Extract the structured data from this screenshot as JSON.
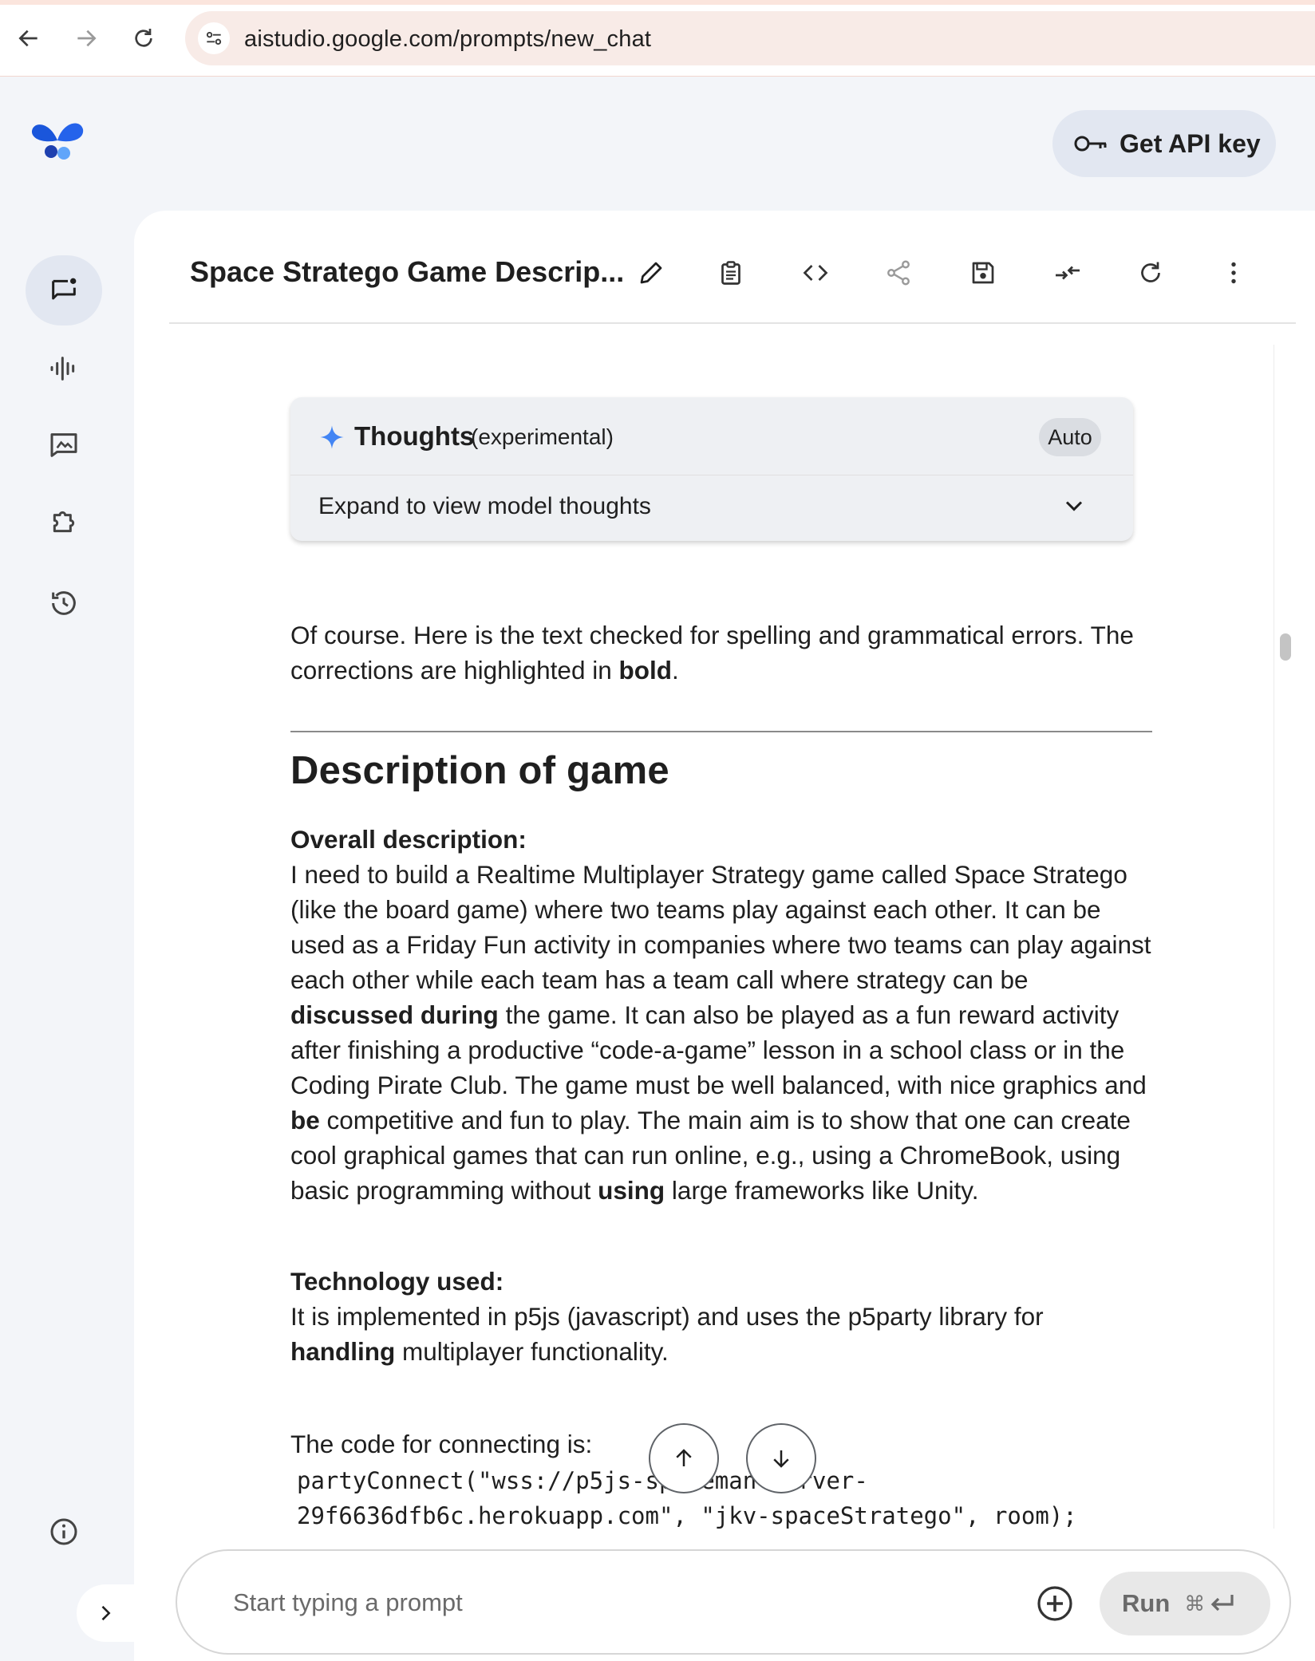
{
  "browser": {
    "url": "aistudio.google.com/prompts/new_chat"
  },
  "header": {
    "api_button_label": "Get API key"
  },
  "toolbar": {
    "title": "Space Stratego Game Descrip..."
  },
  "thoughts": {
    "title": "Thoughts",
    "subtitle": "(experimental)",
    "badge": "Auto",
    "expand_label": "Expand to view model thoughts"
  },
  "response": {
    "intro_1": "Of course. Here is the text checked for spelling and grammatical errors. The corrections are highlighted in ",
    "intro_bold": "bold",
    "intro_2": ".",
    "heading": "Description of game",
    "overall": {
      "label": "Overall description:",
      "t1": "I need to build a Realtime Multiplayer Strategy game called Space Stratego (like the board game) where two teams play against each other. It can be used as a Friday Fun activity in companies where two teams can play against each other while each team has a team call where strategy can be ",
      "b1": "discussed during",
      "t2": " the game. It can also be played as a fun reward activity after finishing a productive “code-a-game” lesson in a school class or in the Coding Pirate Club. The game must be well balanced, with nice graphics and ",
      "b2": "be",
      "t3": " competitive and fun to play. The main aim is to show that one can create cool graphical games that can run online, e.g., using a ChromeBook, using basic programming without ",
      "b3": "using",
      "t4": " large frameworks like Unity."
    },
    "tech": {
      "label": "Technology used:",
      "t1": "It is implemented in p5js (javascript) and uses the p5party library for ",
      "b1": "handling",
      "t2": " multiplayer functionality."
    },
    "code_intro": "The code for connecting is:",
    "code_line_1": "partyConnect(\"wss://p5js-spaceman-server-",
    "code_line_2": "29f6636dfb6c.herokuapp.com\", \"jkv-spaceStratego\", room);"
  },
  "prompt": {
    "placeholder": "Start typing a prompt",
    "run_label": "Run",
    "run_shortcut": "⌘"
  },
  "colors": {
    "accent": "#4285f4",
    "logo": "#1a56db",
    "surface": "#f3f5f9"
  }
}
